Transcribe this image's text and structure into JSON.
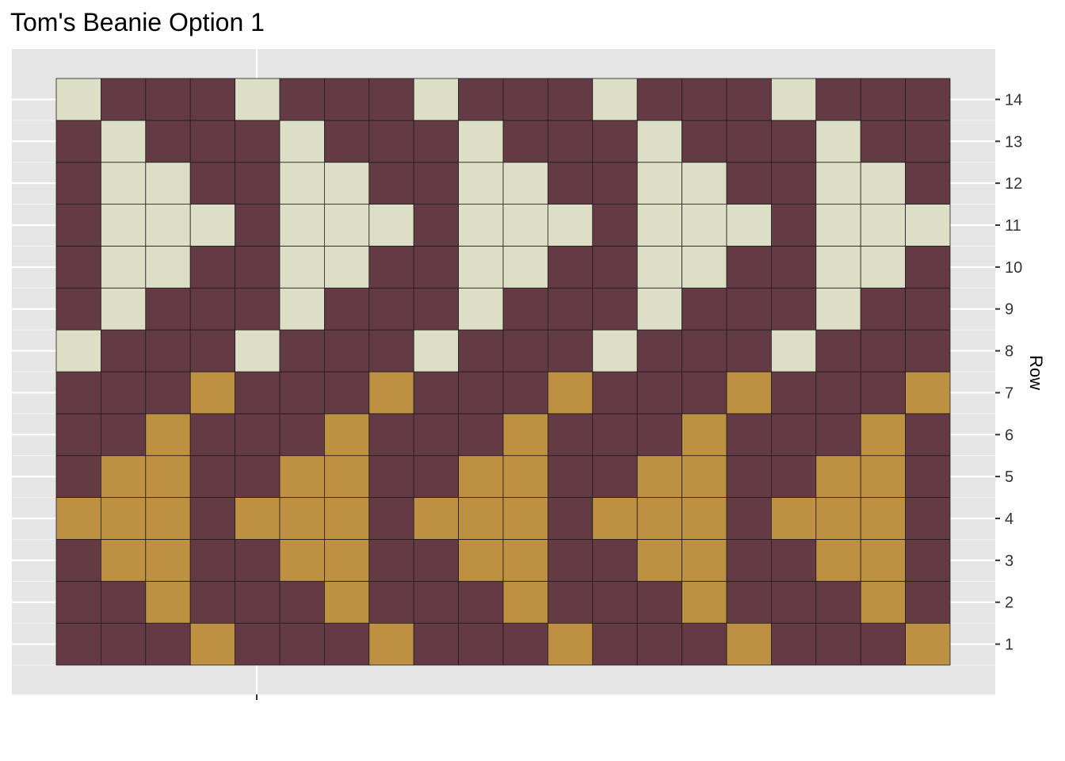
{
  "chart_data": {
    "type": "heatmap",
    "title": "Tom's Beanie Option 1",
    "ylabel": "Row",
    "xlabel": "",
    "y_ticks": [
      "1",
      "2",
      "3",
      "4",
      "5",
      "6",
      "7",
      "8",
      "9",
      "10",
      "11",
      "12",
      "13",
      "14"
    ],
    "y_axis_position": "right",
    "n_columns": 20,
    "legend": "none",
    "grid": true,
    "colors": {
      "M": "#643a44",
      "C": "#dcdfc5",
      "G": "#be9042"
    },
    "color_names": {
      "M": "maroon",
      "C": "cream",
      "G": "gold"
    },
    "rows_bottom_to_top": [
      "MMMGMMMGMMMGMMMGMMMG",
      "MMGMMMGMMMGMMMGMMMGM",
      "MGGMMGGMMGGMMGGMMGGM",
      "GGGMGGGMGGGMGGGMGGGM",
      "MGGMMGGMMGGMMGGMMGGM",
      "MMGMMMGMMMGMMMGMMMGM",
      "MMMGMMMGMMMGMMMGMMMG",
      "CMMMCMMMCMMMCMMMCMMM",
      "MCMMMCMMMCMMMCMMMCMM",
      "MCCMMCCMMCCMMCCMMCCM",
      "MCCCMCCCMCCCMCCCMCCC",
      "MCCMMCCMMCCMMCCMMCCM",
      "MCMMMCMMMCMMMCMMMCMM",
      "CMMMCMMMCMMMCMMMCMMM"
    ]
  }
}
